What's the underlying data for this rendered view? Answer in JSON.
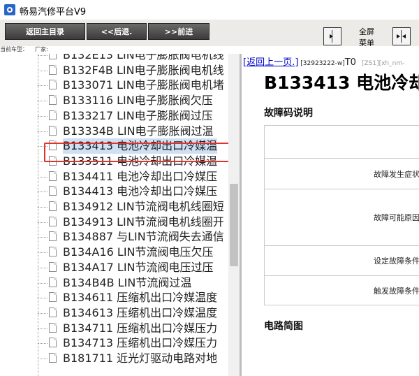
{
  "app": {
    "title": "畅易汽修平台V9"
  },
  "toolbar": {
    "back_main": "返回主目录",
    "prev": "<<后退.",
    "next": ">>前进",
    "fullscreen_l1": "全屏",
    "fullscreen_l2": "菜单"
  },
  "model_bar": {
    "car_model": "当前车型：",
    "manufacturer": "厂家:"
  },
  "tree": {
    "items": [
      "B132E13 LIN电子膨胀阀电机线",
      "B132F4B LIN电子膨胀阀电机线",
      "B133071 LIN电子膨胀阀电机堵",
      "B133116 LIN电子膨胀阀欠压",
      "B133217 LIN电子膨胀阀过压",
      "B13334B LIN电子膨胀阀过温",
      "B133413 电池冷却出口冷媒温",
      "B133511 电池冷却出口冷媒温",
      "B134411 电池冷却出口冷媒压",
      "B134413 电池冷却出口冷媒压",
      "B134912 LIN节流阀电机线圈短",
      "B134913 LIN节流阀电机线圈开",
      "B134887 与LIN节流阀失去通信",
      "B134A16 LIN节流阀电压欠压",
      "B134A17 LIN节流阀电压过压",
      "B134B4B LIN节流阀过温",
      "B134611 压缩机出口冷媒温度",
      "B134613 压缩机出口冷媒温度",
      "B134711 压缩机出口冷媒压力",
      "B134713 压缩机出口冷媒压力",
      "B181711 近光灯驱动电路对地"
    ],
    "selected_index": 6
  },
  "detail": {
    "back_link": "[返回上一页.]",
    "code_ref": "[32923222-w]",
    "code_t": "T0",
    "code_ref2": "[ZS1][xh_nm-",
    "title": "B133413 电池冷却",
    "desc_heading": "故障码说明",
    "rows": [
      "",
      "故障发生症状",
      "故障可能原因",
      "设定故障条件",
      "触发故障条件"
    ],
    "circuit_heading": "电路简图"
  },
  "colors": {
    "selection": "#cfe0f5",
    "highlight": "#e0332b",
    "link": "#0000cc"
  }
}
